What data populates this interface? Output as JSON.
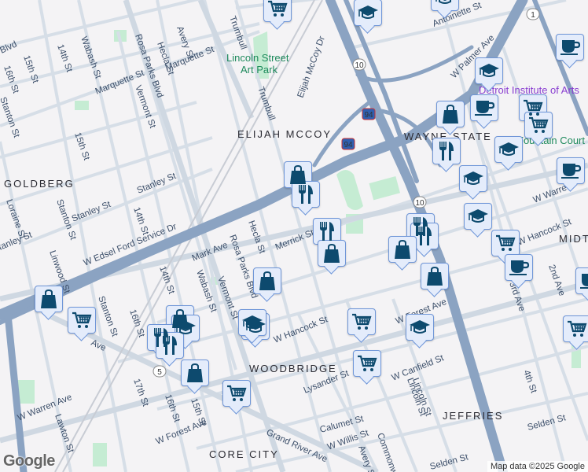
{
  "labels": {
    "streets": [
      "Avery St",
      "Trumbull",
      "Hecla St",
      "Wabash St",
      "14th St",
      "15th St",
      "16th St",
      "Blvd",
      "Rosa Parks Blvd",
      "Marquette St",
      "Marquette St",
      "Vermont St",
      "Elijah McCoy Dr",
      "Trumbull",
      "Stanton St",
      "15th St",
      "Stanley St",
      "Stanley St",
      "Loraine St",
      "Stanton St",
      "14th St",
      "Linwood St",
      "W Edsel Ford Service Dr",
      "tanley St",
      "Mark Ave",
      "Hecla St",
      "Merrick St",
      "Rosa Parks Blvd",
      "Vermont St",
      "Wabash St",
      "14th St",
      "16th St",
      "Stanton St",
      "W Hancock St",
      "W Forest Ave",
      "W Canfield St",
      "Lysander St",
      "Lincoln St",
      "17th St",
      "16th St",
      "15th St",
      "W Warren Ave",
      "Lawton St",
      "W Forest Ave",
      "Grand River Ave",
      "Calumet St",
      "W Willis St",
      "Commonwealth",
      "Avery St",
      "Selden St",
      "Selden St",
      "4th St",
      "2nd Ave",
      "3rd Ave",
      "Antoinette St",
      "W Palmer Ave",
      "W Warren",
      "W Hancock St",
      "Ave",
      "Lincoln St"
    ],
    "neighborhoods": [
      "ELIJAH MCCOY",
      "GOLDBERG",
      "WOODBRIDGE",
      "CORE CITY",
      "JEFFRIES",
      "WAYNE STATE",
      "MIDT"
    ],
    "parks": [
      "Lincoln Street",
      "Art Park",
      "Fountain Court"
    ],
    "poi": [
      "Detroit Institute of Arts"
    ],
    "shields": [
      "10",
      "10",
      "94",
      "94",
      "5",
      "1"
    ]
  },
  "markers": [
    "cart",
    "graduation-cap",
    "graduation-cap",
    "coffee",
    "graduation-cap",
    "shopping-bag",
    "coffee",
    "cart",
    "cart",
    "graduation-cap",
    "coffee",
    "shopping-bag",
    "restaurant",
    "restaurant",
    "graduation-cap",
    "graduation-cap",
    "restaurant",
    "restaurant",
    "cart",
    "coffee",
    "restaurant",
    "shopping-bag",
    "shopping-bag",
    "shopping-bag",
    "shopping-bag",
    "shopping-bag",
    "cart",
    "shopping-bag",
    "graduation-cap",
    "restaurant",
    "restaurant",
    "graduation-cap",
    "cart",
    "graduation-cap",
    "cart",
    "shopping-bag",
    "cart",
    "cart",
    "coffee",
    "graduation-cap"
  ],
  "google_logo": "Google",
  "attribution": "Map data ©2025 Google",
  "colors": {
    "marker_fill": "#e4ecfb",
    "marker_border": "#6f96d8",
    "icon": "#0d4a6e",
    "freeway": "#8ba3c2",
    "road": "#d5dde6",
    "park": "#bfeacf"
  }
}
